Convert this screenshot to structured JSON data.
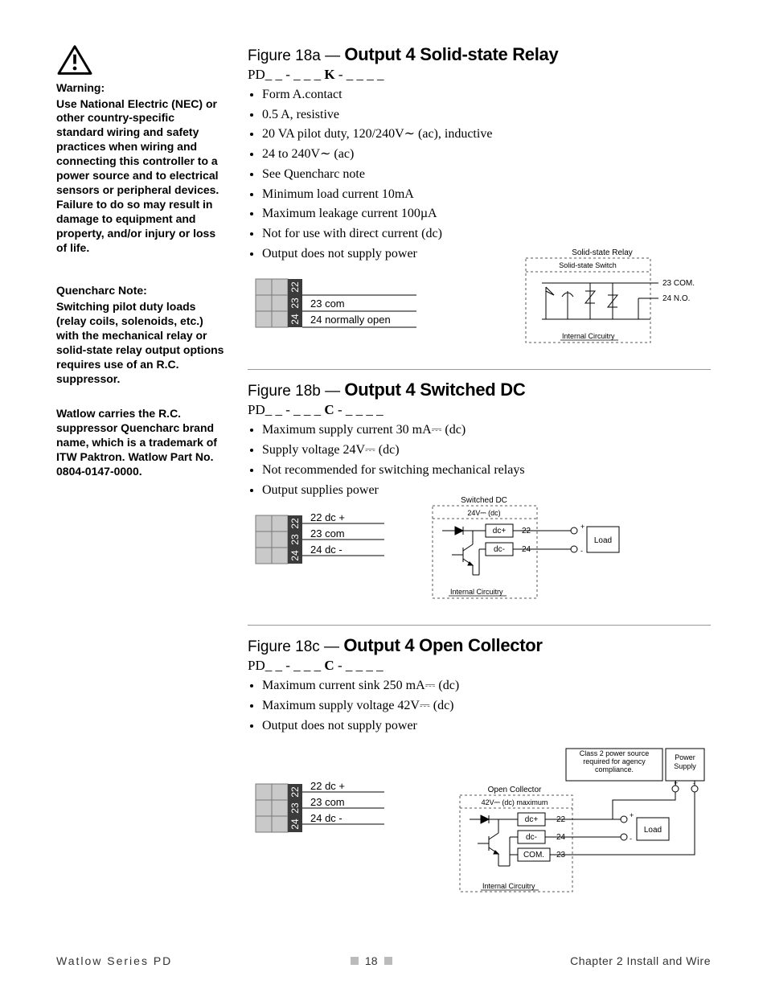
{
  "sidebar": {
    "warning_head": "Warning:",
    "warning_body": "Use National Electric (NEC) or other country-specific standard wiring and safety practices when wiring and connecting this controller to a power source and to electrical sensors or peripheral devices. Failure to do so may result in damage to equipment and property, and/or injury or loss of life.",
    "quench_head": "Quencharc Note:",
    "quench_body": "Switching pilot duty loads (relay coils, solenoids, etc.) with the mechanical relay or solid-state relay output options requires use of an R.C. suppressor.",
    "brand_body": "Watlow carries the R.C. suppressor Quencharc brand name, which is a trademark of ITW Paktron. Watlow Part No. 0804-0147-0000."
  },
  "fig_a": {
    "lead": "Figure 18a — ",
    "title": "Output 4 Solid-state Relay",
    "part_prefix": "PD_ _ - _ _ _ ",
    "part_key": "K",
    "part_suffix": " - _ _ _ _",
    "bullets": [
      "Form A.contact",
      "0.5 A, resistive",
      "20 VA pilot duty, 120/240V∼ (ac), inductive",
      "24 to 240V∼ (ac)",
      "See Quencharc note",
      "Minimum load current 10mA",
      "Maximum leakage current 100µA",
      "Not for use with direct current (dc)",
      "Output does not supply power"
    ],
    "terminals": {
      "n22": "22",
      "n23": "23",
      "n24": "24",
      "l23": "23  com",
      "l24": "24  normally open"
    },
    "schem": {
      "top": "Solid-state Relay",
      "switch": "Solid-state Switch",
      "t23": "23  COM.",
      "t24": "24  N.O.",
      "int": "Internal Circuitry"
    }
  },
  "fig_b": {
    "lead": "Figure 18b — ",
    "title": "Output 4 Switched DC",
    "part_prefix": "PD_ _ - _ _ _ ",
    "part_key": "C",
    "part_suffix": " - _ _ _ _",
    "bullets": [
      "Maximum supply current 30 mA⎓ (dc)",
      "Supply voltage 24V⎓ (dc)",
      "Not recommended for switching mechanical relays",
      "Output supplies power"
    ],
    "terminals": {
      "n22": "22",
      "n23": "23",
      "n24": "24",
      "l22": "22  dc +",
      "l23": "23  com",
      "l24": "24  dc -"
    },
    "schem": {
      "top": "Switched DC",
      "volt": "24V⎓ (dc)",
      "dcp": "dc+",
      "dcm": "dc-",
      "p22": "22",
      "p24": "24",
      "load": "Load",
      "int": "Internal Circuitry"
    }
  },
  "fig_c": {
    "lead": "Figure 18c — ",
    "title": "Output 4 Open Collector",
    "part_prefix": "PD_ _ - _ _ _ ",
    "part_key": "C",
    "part_suffix": " - _ _ _ _",
    "bullets": [
      "Maximum current sink 250 mA⎓ (dc)",
      "Maximum supply voltage 42V⎓ (dc)",
      "Output does not supply power"
    ],
    "terminals": {
      "n22": "22",
      "n23": "23",
      "n24": "24",
      "l22": "22  dc +",
      "l23": "23 com",
      "l24": "24  dc -"
    },
    "schem": {
      "top": "Open Collector",
      "volt": "42V⎓ (dc) maximum",
      "dcp": "dc+",
      "dcm": "dc-",
      "com": "COM.",
      "p22": "22",
      "p23": "23",
      "p24": "24",
      "load": "Load",
      "class2": "Class 2 power source required for agency compliance.",
      "ps": "Power Supply",
      "int": "Internal Circuitry"
    }
  },
  "footer": {
    "left": "Watlow Series PD",
    "page": "18",
    "right": "Chapter 2 Install and Wire"
  }
}
